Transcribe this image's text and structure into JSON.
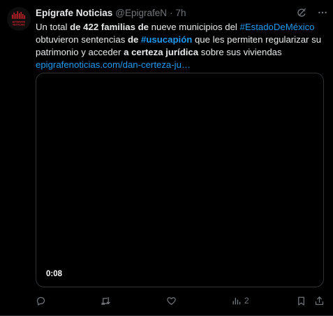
{
  "tweet": {
    "author_name": "Epígrafe Noticias",
    "author_handle": "@EpigrafeN",
    "separator": "·",
    "time": "7h",
    "avatar": {
      "logo_lines": [
        "EPÍGRAFE",
        "NOTICIAS"
      ],
      "color": "#d6232a"
    },
    "text": {
      "p1": "Un total ",
      "b1": "de 422 familias de",
      "p2": " nueve municipios del ",
      "h1": "#EstadoDeMéxico",
      "p3": " obtuvieron sentencias ",
      "b2": "de ",
      "h2": "#usucapión",
      "p4": " que les permiten regularizar su patrimonio y acceder ",
      "b3": "a certeza jurídica",
      "p5": " sobre sus viviendas",
      "link": "epigrafenoticias.com/dan-certeza-ju…"
    },
    "media": {
      "duration": "0:08"
    },
    "metrics": {
      "views": "2"
    }
  },
  "icons": {
    "grok": "grok-icon",
    "more": "more-icon",
    "reply": "reply-icon",
    "retweet": "retweet-icon",
    "like": "like-icon",
    "views": "views-icon",
    "bookmark": "bookmark-icon",
    "share": "share-icon"
  },
  "colors": {
    "background": "#000000",
    "text": "#e7e9ea",
    "secondary": "#71767b",
    "link": "#1d9bf0",
    "border": "#2f3336"
  }
}
